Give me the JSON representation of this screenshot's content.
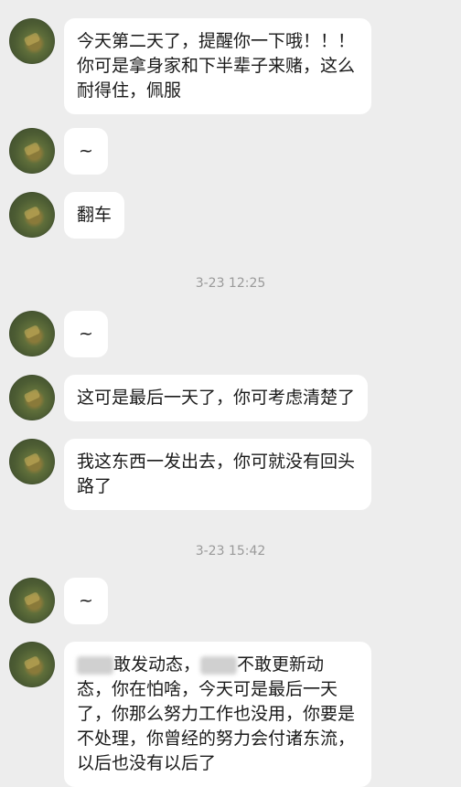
{
  "messages": [
    {
      "text": "今天第二天了，提醒你一下哦！！！你可是拿身家和下半辈子来赌，这么耐得住，佩服"
    },
    {
      "text": "~"
    },
    {
      "text": "翻车"
    },
    {
      "timestamp": "3-23 12:25"
    },
    {
      "text": "~"
    },
    {
      "text": "这可是最后一天了，你可考虑清楚了"
    },
    {
      "text": "我这东西一发出去，你可就没有回头路了"
    },
    {
      "timestamp": "3-23 15:42"
    },
    {
      "text": "~"
    },
    {
      "text_part1": "敢发动态，",
      "text_part2": "不敢更新动态，你在怕啥，今天可是最后一天了，你那么努力工作也没用，你要是不处理，你曾经的努力会付诸东流，以后也没有以后了"
    }
  ]
}
